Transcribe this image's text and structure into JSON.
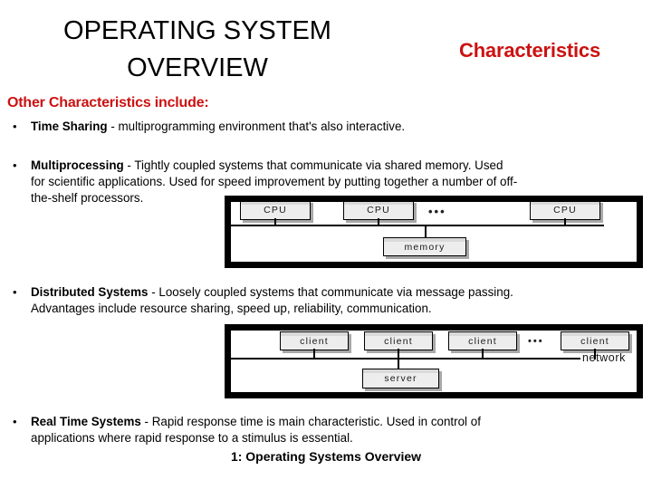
{
  "slide": {
    "title_line1": "OPERATING SYSTEM",
    "title_line2": "OVERVIEW",
    "header_accent": "Characteristics",
    "section_heading": "Other Characteristics include:",
    "bullet_marker": "•",
    "footer": "1: Operating Systems Overview",
    "accent_color": "#CC1111"
  },
  "bullets": [
    {
      "lead": "Time Sharing",
      "body": " - multiprogramming environment that's also interactive."
    },
    {
      "lead": "Multiprocessing",
      "body_line1": "  - Tightly coupled systems that communicate via shared memory.  Used",
      "body_line2": "for scientific applications. Used for speed improvement by putting together a number of off-",
      "body_line3": "the-shelf processors."
    },
    {
      "lead": "Distributed Systems",
      "body_line1": " - Loosely coupled systems that communicate via message passing.",
      "body_line2": "Advantages include resource sharing, speed up, reliability, communication."
    },
    {
      "lead": "Real Time Systems",
      "body_line1": " - Rapid response time is main characteristic.  Used in control of",
      "body_line2": "applications where rapid response to a stimulus is essential."
    }
  ],
  "diagrams": {
    "multiprocessing": {
      "nodes": [
        {
          "label": "CPU"
        },
        {
          "label": "CPU"
        },
        {
          "label": "CPU"
        }
      ],
      "ellipsis": "•••",
      "memory_label": "memory"
    },
    "distributed": {
      "nodes": [
        {
          "label": "client"
        },
        {
          "label": "client"
        },
        {
          "label": "client"
        },
        {
          "label": "client"
        }
      ],
      "ellipsis": "•••",
      "network_label": "network",
      "server_label": "server"
    }
  }
}
